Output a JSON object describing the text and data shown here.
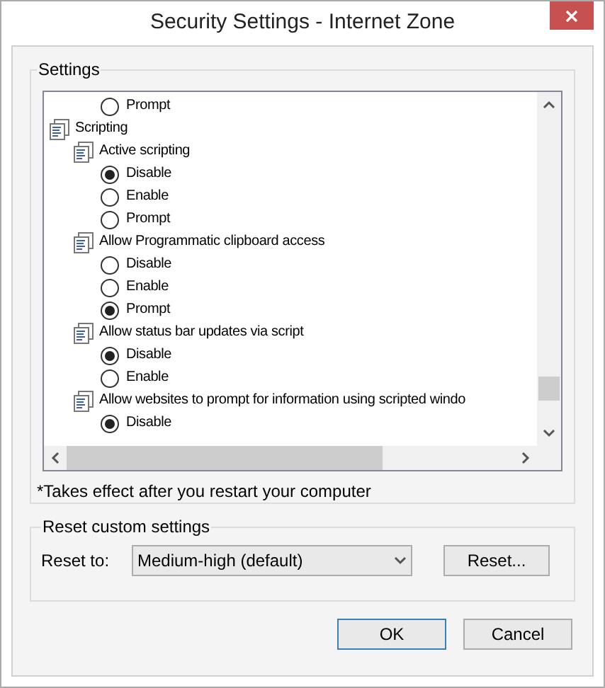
{
  "window": {
    "title": "Security Settings - Internet Zone"
  },
  "settings": {
    "label": "Settings",
    "items": [
      {
        "kind": "option",
        "label": "Prompt",
        "selected": false
      },
      {
        "kind": "group",
        "label": "Scripting",
        "children": [
          {
            "kind": "setting",
            "label": "Active scripting",
            "children": [
              {
                "kind": "option",
                "label": "Disable",
                "selected": true
              },
              {
                "kind": "option",
                "label": "Enable",
                "selected": false
              },
              {
                "kind": "option",
                "label": "Prompt",
                "selected": false
              }
            ]
          },
          {
            "kind": "setting",
            "label": "Allow Programmatic clipboard access",
            "children": [
              {
                "kind": "option",
                "label": "Disable",
                "selected": false
              },
              {
                "kind": "option",
                "label": "Enable",
                "selected": false
              },
              {
                "kind": "option",
                "label": "Prompt",
                "selected": true
              }
            ]
          },
          {
            "kind": "setting",
            "label": "Allow status bar updates via script",
            "children": [
              {
                "kind": "option",
                "label": "Disable",
                "selected": true
              },
              {
                "kind": "option",
                "label": "Enable",
                "selected": false
              }
            ]
          },
          {
            "kind": "setting",
            "label": "Allow websites to prompt for information using scripted windo",
            "children": [
              {
                "kind": "option",
                "label": "Disable",
                "selected": true
              }
            ]
          }
        ]
      }
    ],
    "note": "*Takes effect after you restart your computer"
  },
  "reset": {
    "label": "Reset custom settings",
    "field_label": "Reset to:",
    "value": "Medium-high (default)",
    "button": "Reset..."
  },
  "buttons": [
    {
      "label": "OK",
      "default": true
    },
    {
      "label": "Cancel",
      "default": false
    }
  ]
}
